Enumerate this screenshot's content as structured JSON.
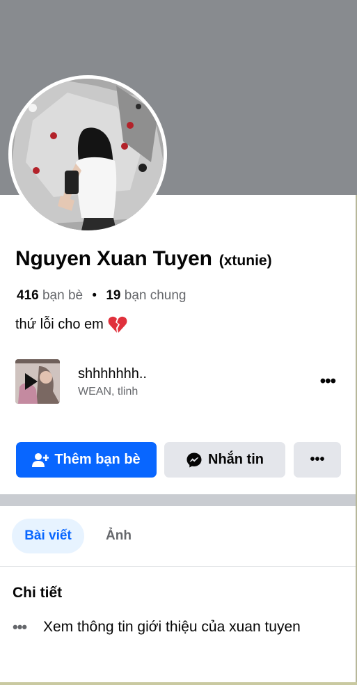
{
  "profile": {
    "name": "Nguyen Xuan Tuyen",
    "username": "(xtunie)",
    "friends_count": "416",
    "friends_label": "bạn bè",
    "separator": "•",
    "mutual_count": "19",
    "mutual_label": "bạn chung",
    "bio": "thứ lỗi cho em",
    "bio_emoji": "broken-heart-icon"
  },
  "music": {
    "title": "shhhhhhh..",
    "artist": "WEAN, tlinh",
    "more": "•••"
  },
  "actions": {
    "add_friend": "Thêm bạn bè",
    "message": "Nhắn tin",
    "more": "•••"
  },
  "tabs": {
    "posts": "Bài viết",
    "photos": "Ảnh"
  },
  "details": {
    "title": "Chi tiết",
    "dots": "•••",
    "about_link": "Xem thông tin giới thiệu của xuan tuyen"
  },
  "colors": {
    "primary": "#0866ff",
    "cover": "#888b8f",
    "secondary_button": "#e4e6eb",
    "active_tab_bg": "#e7f3ff"
  }
}
